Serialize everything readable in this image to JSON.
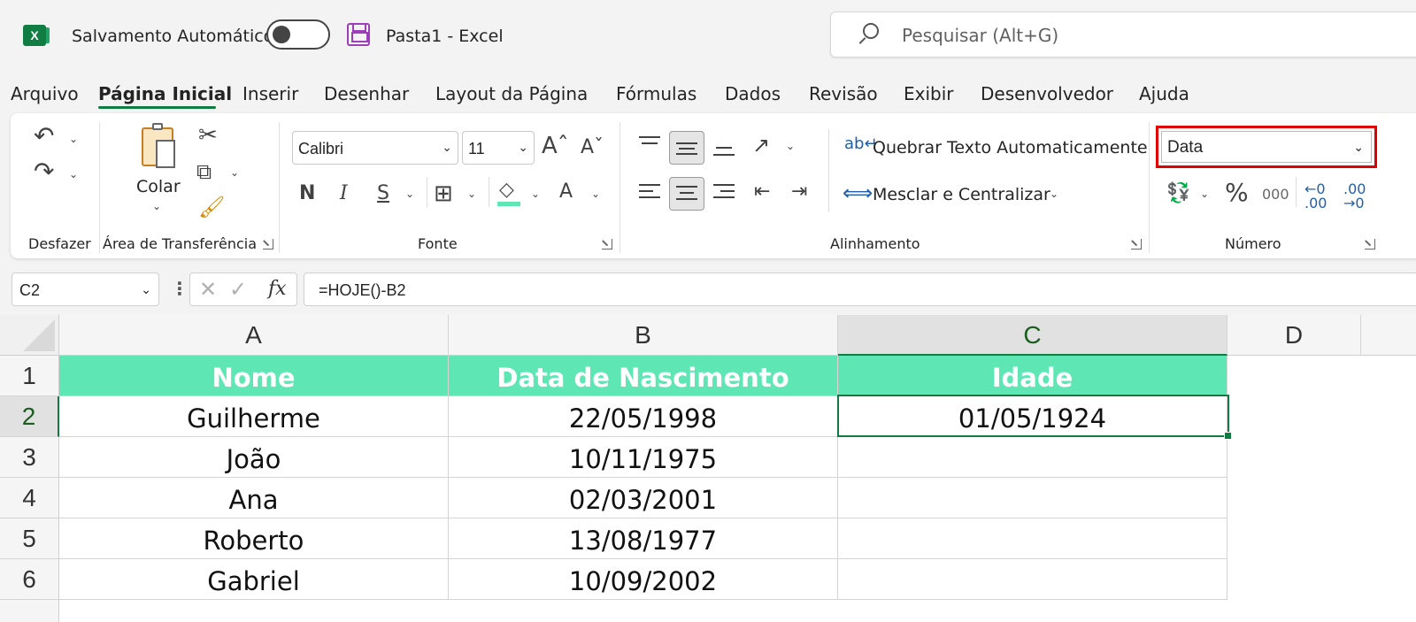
{
  "title_bar": {
    "autosave_label": "Salvamento Automático",
    "document_title": "Pasta1  -  Excel",
    "search_placeholder": "Pesquisar (Alt+G)"
  },
  "menu": {
    "items": [
      "Arquivo",
      "Página Inicial",
      "Inserir",
      "Desenhar",
      "Layout da Página",
      "Fórmulas",
      "Dados",
      "Revisão",
      "Exibir",
      "Desenvolvedor",
      "Ajuda"
    ],
    "active": "Página Inicial"
  },
  "ribbon": {
    "groups": {
      "undo": "Desfazer",
      "clipboard": "Área de Transferência",
      "font": "Fonte",
      "alignment": "Alinhamento",
      "number": "Número"
    },
    "paste_label": "Colar",
    "font_name": "Calibri",
    "font_size": "11",
    "bold": "N",
    "italic": "I",
    "underline": "S",
    "wrap_text": "Quebrar Texto Automaticamente",
    "merge_center": "Mesclar e Centralizar",
    "number_format": "Data",
    "thousands": "000"
  },
  "formula_bar": {
    "name_box": "C2",
    "formula": "=HOJE()-B2"
  },
  "sheet": {
    "columns": [
      "A",
      "B",
      "C",
      "D"
    ],
    "rows": [
      "1",
      "2",
      "3",
      "4",
      "5",
      "6"
    ],
    "header": [
      "Nome",
      "Data de Nascimento",
      "Idade"
    ],
    "data": [
      [
        "Guilherme",
        "22/05/1998",
        "01/05/1924"
      ],
      [
        "João",
        "10/11/1975",
        ""
      ],
      [
        "Ana",
        "02/03/2001",
        ""
      ],
      [
        "Roberto",
        "13/08/1977",
        ""
      ],
      [
        "Gabriel",
        "10/09/2002",
        ""
      ]
    ]
  },
  "colors": {
    "accent": "#107c41",
    "header_fill": "#5ee6b4",
    "highlight": "#e00000"
  }
}
